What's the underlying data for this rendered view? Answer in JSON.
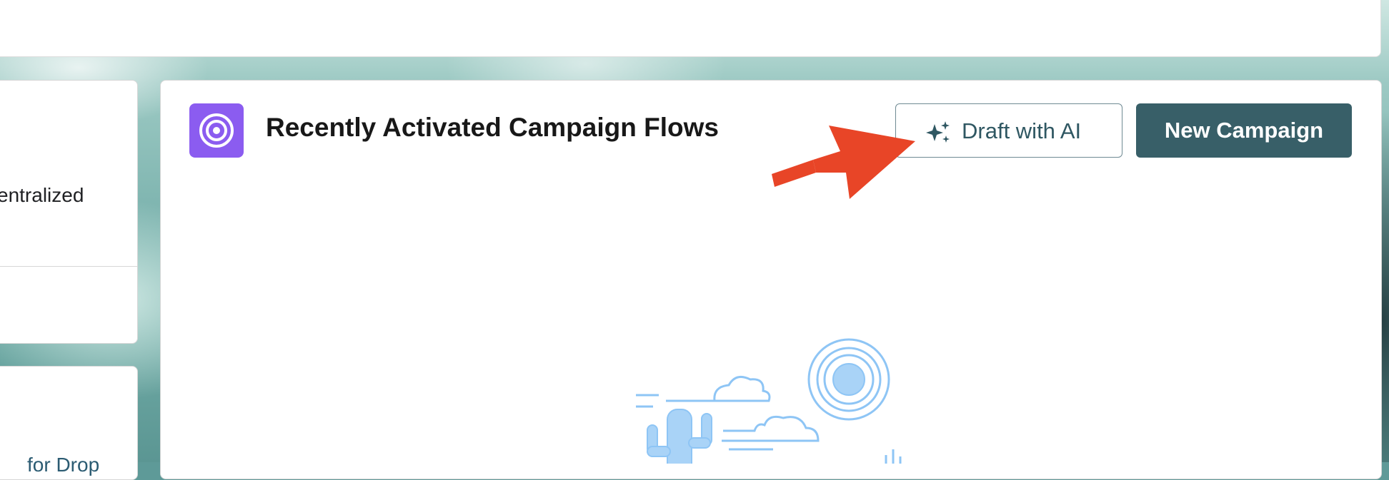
{
  "left_panel": {
    "card_text": "entralized",
    "link_text": "for Drop"
  },
  "main_card": {
    "title": "Recently Activated Campaign Flows",
    "icon": "target-icon",
    "draft_button_label": "Draft with AI",
    "draft_button_icon": "sparkle-icon",
    "new_button_label": "New Campaign"
  },
  "annotation": {
    "arrow_color": "#e84527"
  },
  "colors": {
    "icon_bg": "#8b5cf0",
    "primary_button": "#385f68",
    "illustration": "#8ec5f5"
  }
}
